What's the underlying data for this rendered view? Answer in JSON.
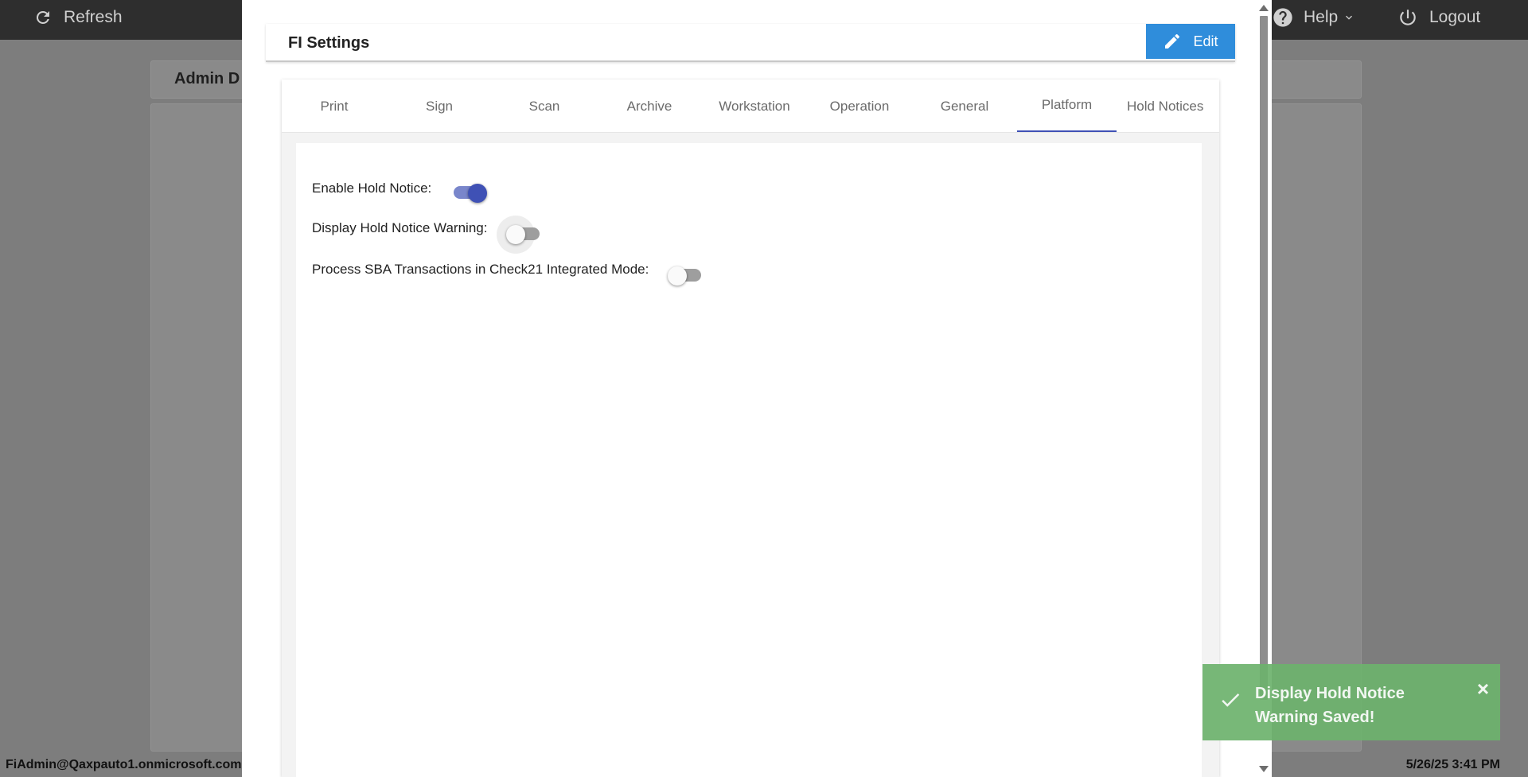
{
  "topbar": {
    "refresh_label": "Refresh",
    "help_label": "Help",
    "logout_label": "Logout"
  },
  "background": {
    "panel_title": "Admin D"
  },
  "footer": {
    "user": "FiAdmin@Qaxpauto1.onmicrosoft.com",
    "datetime": "5/26/25 3:41 PM"
  },
  "modal": {
    "title": "FI Settings",
    "edit_label": "Edit",
    "tabs": [
      {
        "label": "Print",
        "active": false
      },
      {
        "label": "Sign",
        "active": false
      },
      {
        "label": "Scan",
        "active": false
      },
      {
        "label": "Archive",
        "active": false
      },
      {
        "label": "Workstation",
        "active": false
      },
      {
        "label": "Operation",
        "active": false
      },
      {
        "label": "General",
        "active": false
      },
      {
        "label": "Platform",
        "active": true
      },
      {
        "label": "Hold Notices",
        "active": false
      }
    ],
    "settings": [
      {
        "label": "Enable Hold Notice:",
        "enabled": true
      },
      {
        "label": "Display Hold Notice Warning:",
        "enabled": false
      },
      {
        "label": "Process SBA Transactions in Check21 Integrated Mode:",
        "enabled": false
      }
    ]
  },
  "toast": {
    "message": "Display Hold Notice Warning Saved!",
    "close_symbol": "×",
    "color": "#6cb26c"
  },
  "colors": {
    "accent": "#3f51b5",
    "edit_button": "#2f8ddb",
    "topbar": "#2e2e2e"
  }
}
